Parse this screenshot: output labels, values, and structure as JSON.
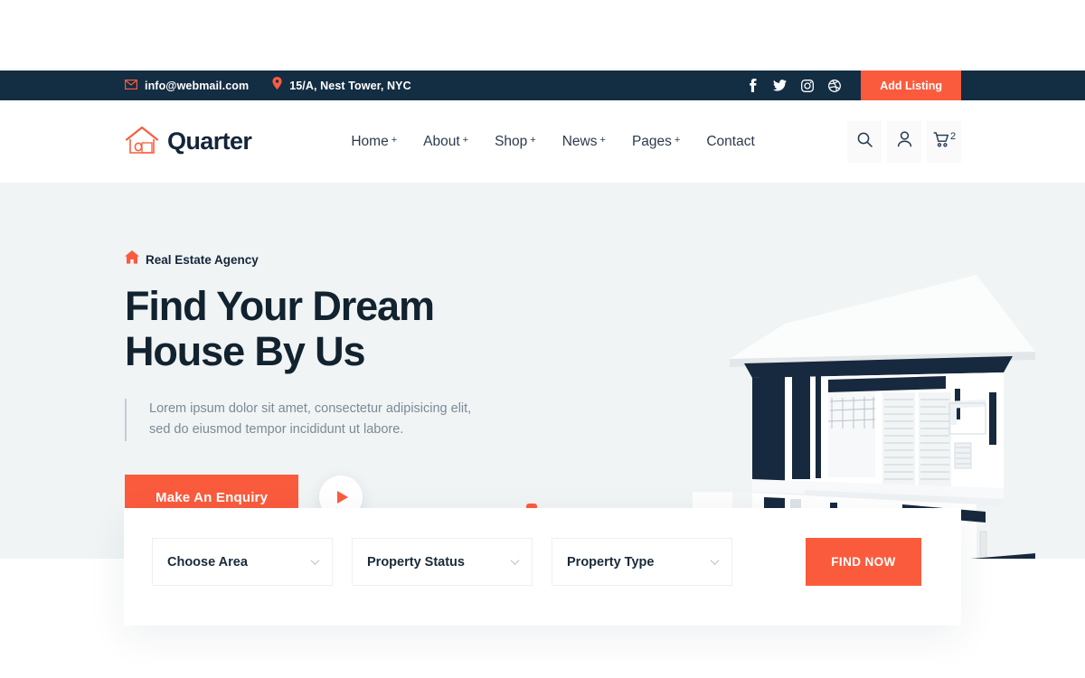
{
  "topbar": {
    "email": "info@webmail.com",
    "address": "15/A, Nest Tower, NYC",
    "email_icon": "envelope-icon",
    "address_icon": "map-pin-icon",
    "socials": [
      "facebook-icon",
      "twitter-icon",
      "instagram-icon",
      "dribbble-icon"
    ],
    "add_listing_label": "Add Listing",
    "bg_color": "#132d43",
    "accent_color": "#fb5b3d"
  },
  "header": {
    "logo_text": "Quarter",
    "logo_icon": "house-outline-icon",
    "nav": [
      {
        "label": "Home",
        "has_submenu": true,
        "plus": "+"
      },
      {
        "label": "About",
        "has_submenu": true,
        "plus": "+"
      },
      {
        "label": "Shop",
        "has_submenu": true,
        "plus": "+"
      },
      {
        "label": "News",
        "has_submenu": true,
        "plus": "+"
      },
      {
        "label": "Pages",
        "has_submenu": true,
        "plus": "+"
      },
      {
        "label": "Contact",
        "has_submenu": false,
        "plus": ""
      }
    ],
    "actions": {
      "search_icon": "search-icon",
      "account_icon": "user-icon",
      "cart_icon": "cart-icon",
      "cart_count": "2"
    }
  },
  "hero": {
    "badge_icon": "house-solid-icon",
    "badge_label": "Real Estate Agency",
    "title_line1": "Find Your Dream",
    "title_line2": "House By Us",
    "subtitle_line1": "Lorem ipsum dolor sit amet, consectetur adipisicing elit,",
    "subtitle_line2": "sed do eiusmod tempor incididunt ut labore.",
    "cta_label": "Make An Enquiry",
    "play_icon": "play-icon",
    "illustration": "modern-two-story-house",
    "bg_color": "#f0f4f5"
  },
  "search_form": {
    "fields": [
      {
        "name": "choose-area",
        "value": "Choose Area"
      },
      {
        "name": "property-status",
        "value": "Property Status"
      },
      {
        "name": "property-type",
        "value": "Property Type"
      }
    ],
    "chevron_icon": "chevron-down-icon",
    "submit_label": "FIND NOW"
  }
}
